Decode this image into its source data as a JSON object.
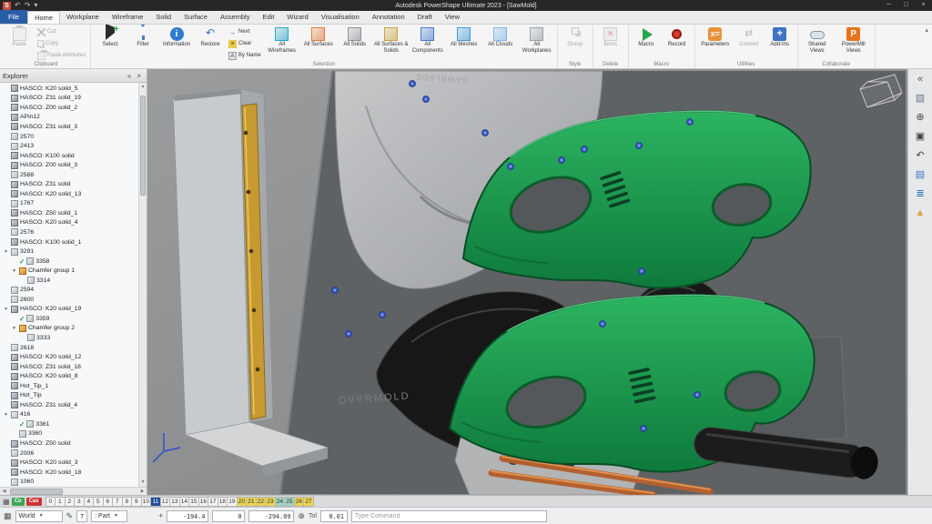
{
  "titlebar": {
    "title": "Autodesk PowerShape Ultimate 2023 - [SawMold]",
    "quick_icons": [
      {
        "name": "app-icon",
        "glyph": "S"
      },
      {
        "name": "undo-icon",
        "glyph": "↶"
      },
      {
        "name": "redo-icon",
        "glyph": "↷"
      },
      {
        "name": "quick-access-menu-icon",
        "glyph": "▾"
      }
    ],
    "window_controls": [
      {
        "name": "minimize-button",
        "glyph": "─"
      },
      {
        "name": "maximize-button",
        "glyph": "□"
      },
      {
        "name": "close-button",
        "glyph": "×"
      }
    ]
  },
  "tabs": {
    "items": [
      "File",
      "Home",
      "Workplane",
      "Wireframe",
      "Solid",
      "Surface",
      "Assembly",
      "Edit",
      "Wizard",
      "Visualisation",
      "Annotation",
      "Draft",
      "View"
    ],
    "active": "Home"
  },
  "ribbon": {
    "clipboard": {
      "label": "Clipboard",
      "paste": "Paste",
      "cut": "Cut",
      "copy": "Copy",
      "paste_attributes": "Paste Attributes"
    },
    "selection": {
      "label": "Selection",
      "select": "Select",
      "filter": "Filter",
      "information": "Information",
      "restore": "Restore",
      "next": "Next",
      "clear": "Clear",
      "by_name": "By Name",
      "all_buttons": [
        "All Wireframes",
        "All Surfaces",
        "All Solids",
        "All Surfaces & Solids",
        "All Components",
        "All Meshes",
        "All Clouds",
        "All Workplanes"
      ]
    },
    "style": {
      "label": "Style",
      "group": "Group"
    },
    "delete": {
      "label": "Delete",
      "items": "Items"
    },
    "macro": {
      "label": "Macro",
      "macro": "Macro",
      "record": "Record"
    },
    "utilities": {
      "label": "Utilities",
      "parameters": "Parameters",
      "convert": "Convert",
      "addins": "Add-Ins"
    },
    "collaborate": {
      "label": "Collaborate",
      "shared_views": "Shared Views",
      "powermill": "PowerMill Views"
    }
  },
  "explorer": {
    "title": "Explorer",
    "items": [
      {
        "label": "HASCO: K20 solid_5",
        "depth": 0,
        "icon": "solid"
      },
      {
        "label": "HASCO: Z31 solid_19",
        "depth": 0,
        "icon": "solid"
      },
      {
        "label": "HASCO: Z00 solid_2",
        "depth": 0,
        "icon": "solid"
      },
      {
        "label": "APin12",
        "depth": 0,
        "icon": "solid"
      },
      {
        "label": "HASCO: Z31 solid_3",
        "depth": 0,
        "icon": "solid"
      },
      {
        "label": "2570",
        "depth": 0,
        "icon": "part"
      },
      {
        "label": "2413",
        "depth": 0,
        "icon": "part"
      },
      {
        "label": "HASCO: K100 solid",
        "depth": 0,
        "icon": "solid"
      },
      {
        "label": "HASCO: Z00 solid_3",
        "depth": 0,
        "icon": "solid"
      },
      {
        "label": "2588",
        "depth": 0,
        "icon": "part"
      },
      {
        "label": "HASCO: Z31 solid",
        "depth": 0,
        "icon": "solid"
      },
      {
        "label": "HASCO: K20 solid_13",
        "depth": 0,
        "icon": "solid"
      },
      {
        "label": "1767",
        "depth": 0,
        "icon": "part"
      },
      {
        "label": "HASCO: Z50 solid_1",
        "depth": 0,
        "icon": "solid"
      },
      {
        "label": "HASCO: K20 solid_4",
        "depth": 0,
        "icon": "solid"
      },
      {
        "label": "2576",
        "depth": 0,
        "icon": "part"
      },
      {
        "label": "HASCO: K100 solid_1",
        "depth": 0,
        "icon": "solid"
      },
      {
        "label": "3291",
        "depth": 0,
        "icon": "part",
        "expander": "open"
      },
      {
        "label": "3358",
        "depth": 1,
        "icon": "part",
        "check": true
      },
      {
        "label": "Chamfer group 1",
        "depth": 1,
        "icon": "chamfer",
        "expander": "open"
      },
      {
        "label": "3314",
        "depth": 2,
        "icon": "part"
      },
      {
        "label": "2594",
        "depth": 0,
        "icon": "part"
      },
      {
        "label": "2600",
        "depth": 0,
        "icon": "part"
      },
      {
        "label": "HASCO: K20 solid_19",
        "depth": 0,
        "icon": "solid",
        "expander": "open"
      },
      {
        "label": "3359",
        "depth": 1,
        "icon": "part",
        "check": true
      },
      {
        "label": "Chamfer group 2",
        "depth": 1,
        "icon": "chamfer",
        "expander": "open"
      },
      {
        "label": "3333",
        "depth": 2,
        "icon": "part"
      },
      {
        "label": "2618",
        "depth": 0,
        "icon": "part"
      },
      {
        "label": "HASCO: K20 solid_12",
        "depth": 0,
        "icon": "solid"
      },
      {
        "label": "HASCO: Z31 solid_18",
        "depth": 0,
        "icon": "solid"
      },
      {
        "label": "HASCO: K20 solid_8",
        "depth": 0,
        "icon": "solid"
      },
      {
        "label": "Hot_Tip_1",
        "depth": 0,
        "icon": "solid"
      },
      {
        "label": "Hot_Tip",
        "depth": 0,
        "icon": "solid"
      },
      {
        "label": "HASCO: Z31 solid_4",
        "depth": 0,
        "icon": "solid"
      },
      {
        "label": "416",
        "depth": 0,
        "icon": "part",
        "expander": "open"
      },
      {
        "label": "3361",
        "depth": 1,
        "icon": "part",
        "check": true
      },
      {
        "label": "3360",
        "depth": 1,
        "icon": "part"
      },
      {
        "label": "HASCO: Z50 solid",
        "depth": 0,
        "icon": "solid"
      },
      {
        "label": "2006",
        "depth": 0,
        "icon": "part"
      },
      {
        "label": "HASCO: K20 solid_3",
        "depth": 0,
        "icon": "solid"
      },
      {
        "label": "HASCO: K20 solid_18",
        "depth": 0,
        "icon": "solid"
      },
      {
        "label": "1060",
        "depth": 0,
        "icon": "part"
      }
    ]
  },
  "viewport": {
    "labels": {
      "overmold": "OVERMOLD",
      "sawblade": "SAWBLADE"
    },
    "colors": {
      "housing_green": "#1f9e4f",
      "rail_gold": "#c79a31",
      "screw_blue": "#3f62cc",
      "rod_copper": "#b2602e"
    }
  },
  "right_toolbar": {
    "icons": [
      {
        "name": "collapse-panel-icon",
        "glyph": "«",
        "color": "#555555"
      },
      {
        "name": "view-cube-icon",
        "glyph": "▧",
        "color": "#6b7b8c"
      },
      {
        "name": "zoom-in-icon",
        "glyph": "⊕",
        "color": "#444444"
      },
      {
        "name": "zoom-window-icon",
        "glyph": "▣",
        "color": "#444444"
      },
      {
        "name": "previous-view-icon",
        "glyph": "↶",
        "color": "#444444"
      },
      {
        "name": "multiple-viewports-icon",
        "glyph": "▤",
        "color": "#3f74c4"
      },
      {
        "name": "levels-stack-icon",
        "glyph": "≣",
        "color": "#2f6fc0"
      },
      {
        "name": "render-pyramid-icon",
        "glyph": "▲",
        "color": "#d7a33a"
      }
    ]
  },
  "levels": {
    "badges": [
      {
        "label": "Co",
        "bg": "#3aa655"
      },
      {
        "label": "Cax",
        "bg": "#cc3333"
      }
    ],
    "numbers": [
      {
        "n": "0",
        "state": ""
      },
      {
        "n": "1",
        "state": ""
      },
      {
        "n": "2",
        "state": ""
      },
      {
        "n": "3",
        "state": ""
      },
      {
        "n": "4",
        "state": ""
      },
      {
        "n": "5",
        "state": ""
      },
      {
        "n": "6",
        "state": ""
      },
      {
        "n": "7",
        "state": ""
      },
      {
        "n": "8",
        "state": ""
      },
      {
        "n": "9",
        "state": ""
      },
      {
        "n": "10",
        "state": ""
      },
      {
        "n": "11",
        "state": "sel"
      },
      {
        "n": "12",
        "state": ""
      },
      {
        "n": "13",
        "state": ""
      },
      {
        "n": "14",
        "state": ""
      },
      {
        "n": "15",
        "state": ""
      },
      {
        "n": "16",
        "state": ""
      },
      {
        "n": "17",
        "state": ""
      },
      {
        "n": "18",
        "state": ""
      },
      {
        "n": "19",
        "state": ""
      },
      {
        "n": "20",
        "state": "yl"
      },
      {
        "n": "21",
        "state": "yl"
      },
      {
        "n": "22",
        "state": "yl"
      },
      {
        "n": "23",
        "state": "yl"
      },
      {
        "n": "24",
        "state": "tl"
      },
      {
        "n": "25",
        "state": "tl"
      },
      {
        "n": "26",
        "state": "yl"
      },
      {
        "n": "27",
        "state": "yl"
      }
    ]
  },
  "status": {
    "workplane": "World",
    "edit_indicator": "7",
    "selection_filter": ": Part",
    "coords": {
      "x": "-194.4",
      "y": "0",
      "z": "-294.09"
    },
    "tol_label": "Tol",
    "tol_value": "0.01",
    "command_placeholder": "Type Command"
  }
}
